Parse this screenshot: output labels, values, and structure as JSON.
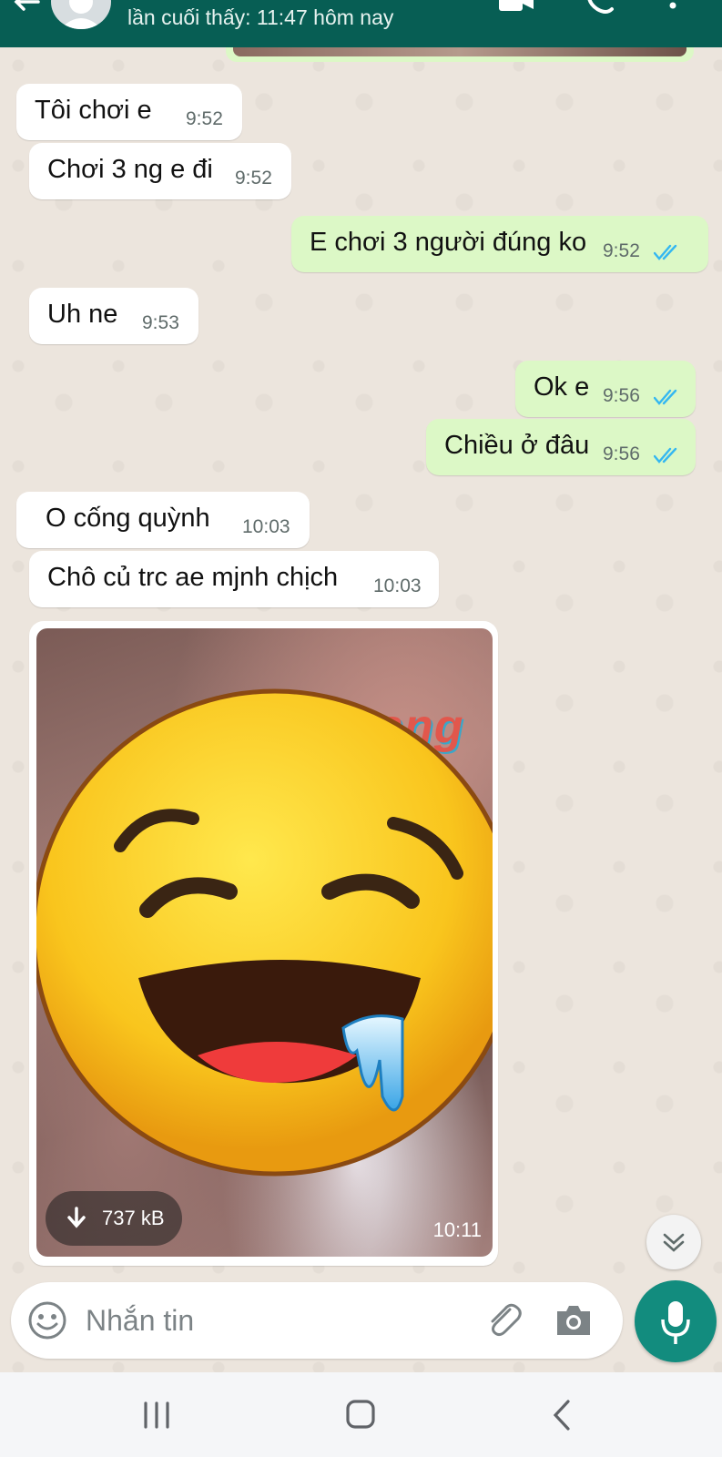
{
  "header": {
    "status": "lần cuối thấy: 11:47 hôm nay",
    "bg_color": "#075e54",
    "icons": [
      "back-arrow-icon",
      "avatar",
      "video-call-icon",
      "voice-call-icon",
      "more-options-icon"
    ]
  },
  "messages": [
    {
      "direction": "in",
      "text": "Tôi chơi e",
      "time": "9:52"
    },
    {
      "direction": "in",
      "text": "Chơi 3 ng e đi",
      "time": "9:52"
    },
    {
      "direction": "out",
      "text": "E chơi 3 người đúng ko",
      "time": "9:52",
      "status": "read"
    },
    {
      "direction": "in",
      "text": "Uh ne",
      "time": "9:53"
    },
    {
      "direction": "out",
      "text": "Ok e",
      "time": "9:56",
      "status": "read"
    },
    {
      "direction": "out",
      "text": "Chiều ở đâu",
      "time": "9:56",
      "status": "read"
    },
    {
      "direction": "in",
      "text": "O cống quỳnh",
      "time": "10:03"
    },
    {
      "direction": "in",
      "text": "Chô củ trc ae mjnh chịch",
      "time": "10:03"
    }
  ],
  "media": {
    "watermark": "Rphang",
    "size_label": "737 kB",
    "time": "10:11",
    "overlay_icon": "drooling-face-emoji"
  },
  "composer": {
    "placeholder": "Nhắn tin",
    "icons": [
      "emoji-icon",
      "paperclip-icon",
      "camera-icon",
      "mic-icon"
    ]
  },
  "colors": {
    "incoming_bubble": "#ffffff",
    "outgoing_bubble": "#dcf8c6",
    "read_ticks": "#34b7f1",
    "accent": "#128c7e"
  }
}
